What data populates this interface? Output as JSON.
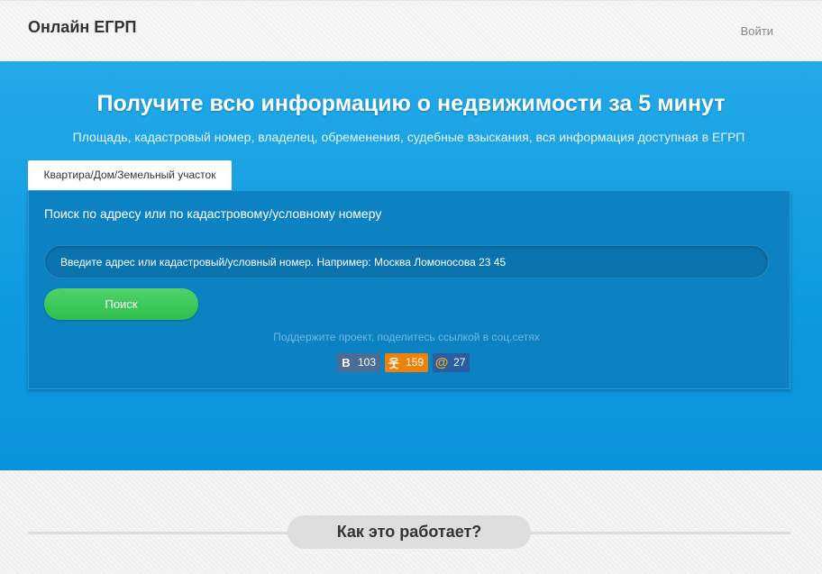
{
  "header": {
    "brand": "Онлайн ЕГРП",
    "login": "Войти"
  },
  "hero": {
    "title": "Получите всю информацию о недвижимости за 5 минут",
    "subtitle": "Площадь, кадастровый номер, владелец, обременения, судебные взыскания, вся информация доступная в ЕГРП",
    "tab_label": "Квартира/Дом/Земельный участок"
  },
  "search": {
    "label": "Поиск по адресу или по кадастровому/условному номеру",
    "placeholder": "Введите адрес или кадастровый/условный номер. Например: Москва Ломоносова 23 45",
    "button": "Поиск"
  },
  "share": {
    "text": "Поддержите проект, поделитесь ссылкой в соц.сетях",
    "buttons": [
      {
        "icon": "vk-icon",
        "glyph": "В",
        "count": "103",
        "color": "#4a6d95"
      },
      {
        "icon": "odnoklassniki-icon",
        "glyph": "웃",
        "count": "159",
        "color": "#ee8208"
      },
      {
        "icon": "mail-ru-icon",
        "glyph": "@",
        "count": "27",
        "color": "#2a5ea1"
      }
    ]
  },
  "how_it_works": {
    "title": "Как это работает?"
  }
}
